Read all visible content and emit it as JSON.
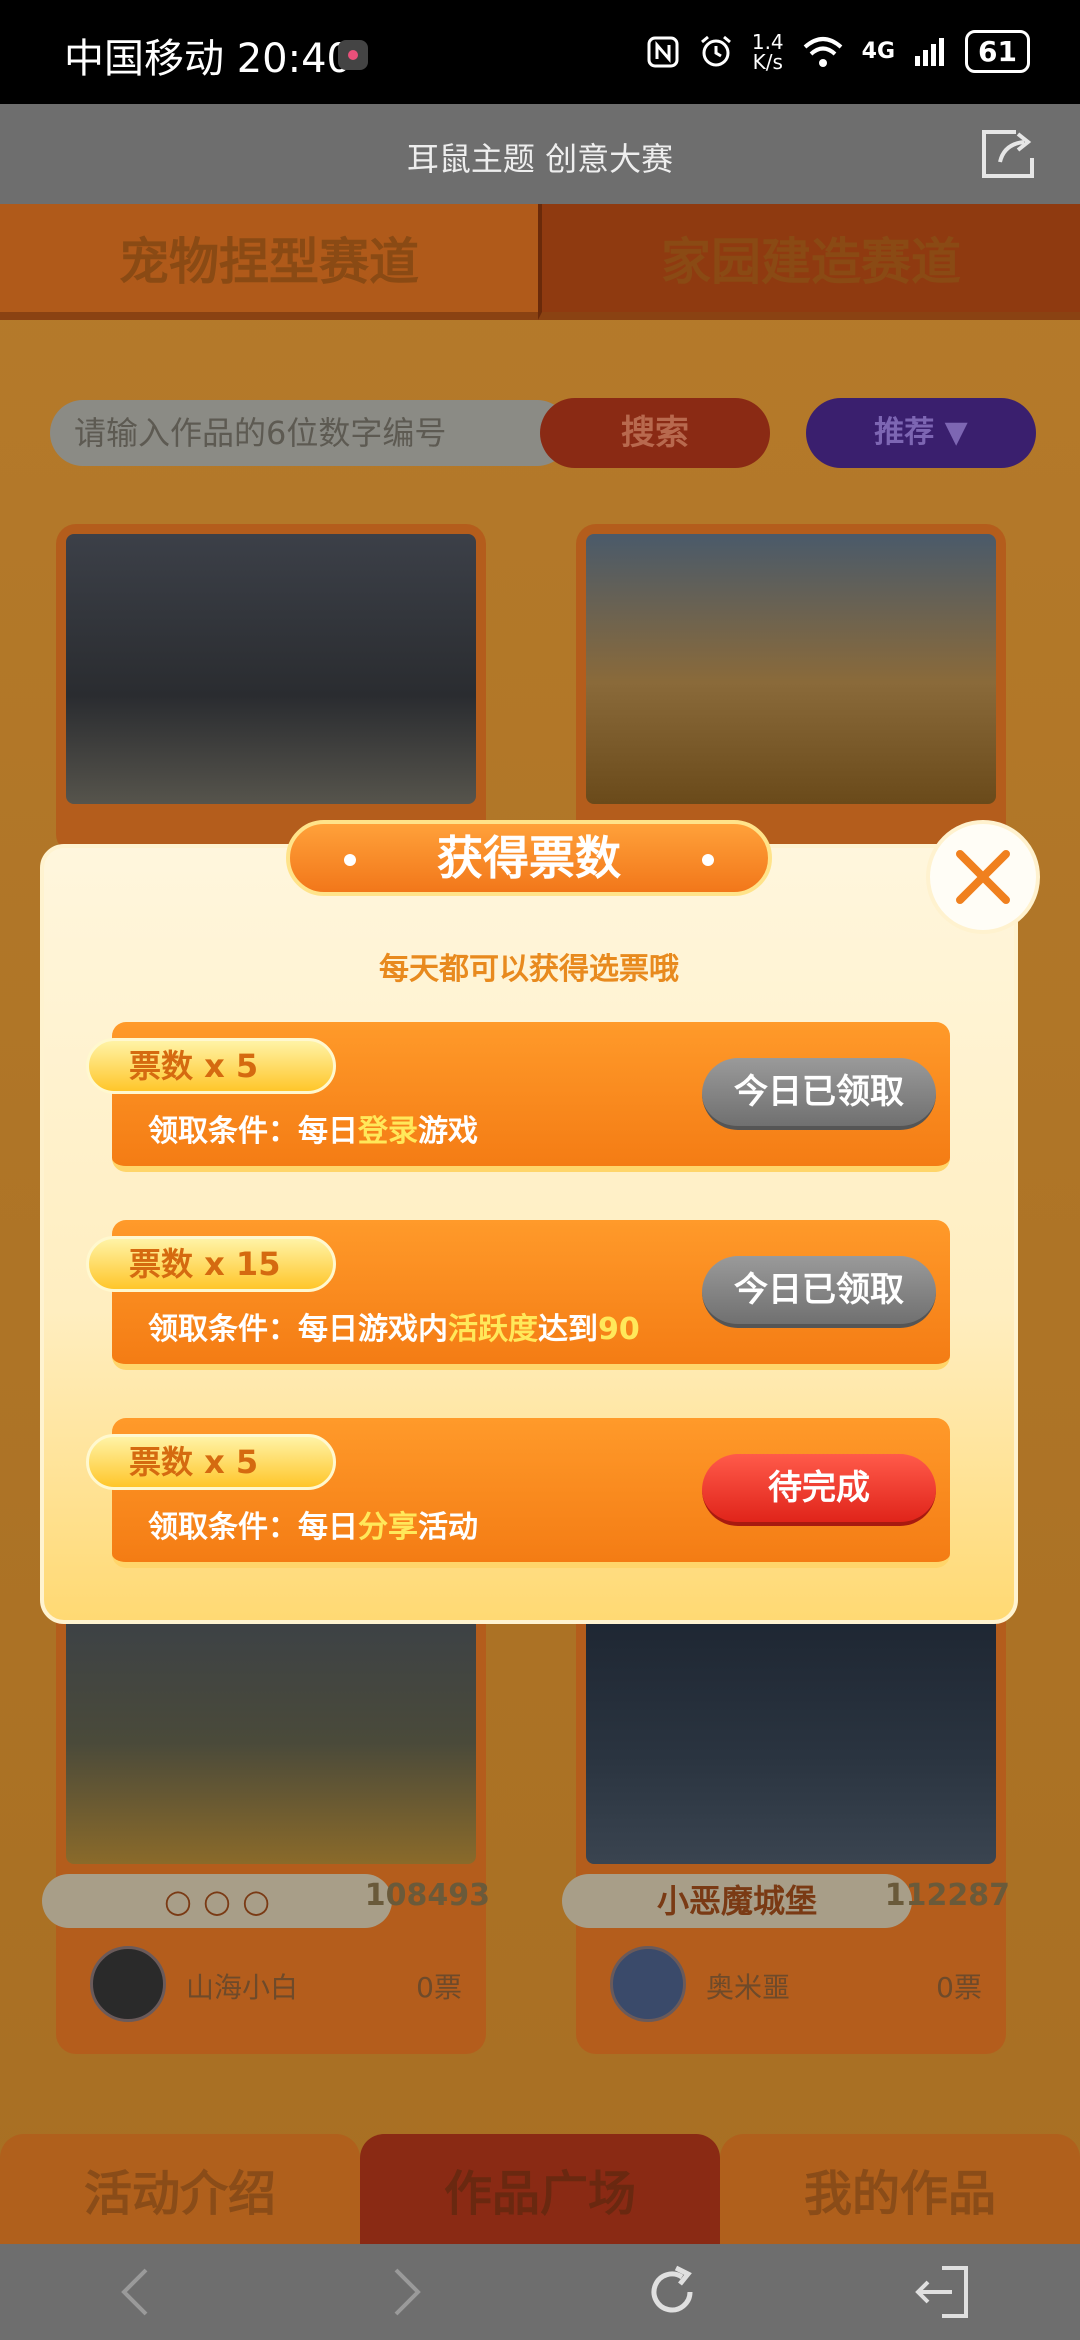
{
  "status_bar": {
    "carrier": "中国移动",
    "time": "20:40",
    "net_speed_value": "1.4",
    "net_speed_unit": "K/s",
    "network": "4G",
    "battery": "61"
  },
  "header": {
    "title": "耳鼠主题 创意大赛"
  },
  "tracks": {
    "left": "宠物捏型赛道",
    "right": "家园建造赛道"
  },
  "search": {
    "placeholder": "请输入作品的6位数字编号",
    "button": "搜索",
    "sort": "推荐 ▼"
  },
  "cards": [
    {
      "name": "○ ○ ○",
      "id": "108493",
      "author": "山海小白",
      "votes": "0票"
    },
    {
      "name": "小恶魔城堡",
      "id": "112287",
      "author": "奥米噩",
      "votes": "0票"
    }
  ],
  "bottom_tabs": {
    "intro": "活动介绍",
    "plaza": "作品广场",
    "mine": "我的作品"
  },
  "modal": {
    "title": "获得票数",
    "subtitle": "每天都可以获得选票哦",
    "tasks": [
      {
        "reward": "票数 x 5",
        "cond_prefix": "领取条件：每日",
        "cond_highlight": "登录",
        "cond_suffix": "游戏",
        "action": "今日已领取"
      },
      {
        "reward": "票数 x 15",
        "cond_prefix": "领取条件：每日游戏内",
        "cond_highlight": "活跃度",
        "cond_suffix": "达到",
        "cond_value": "90",
        "action": "今日已领取"
      },
      {
        "reward": "票数 x 5",
        "cond_prefix": "领取条件：每日",
        "cond_highlight": "分享",
        "cond_suffix": "活动",
        "action": "待完成"
      }
    ]
  },
  "colors": {
    "accent_orange": "#f47c14",
    "highlight_yellow": "#ffe85a",
    "claimed_gray": "#8a8a8a",
    "pending_red": "#e0241a"
  }
}
